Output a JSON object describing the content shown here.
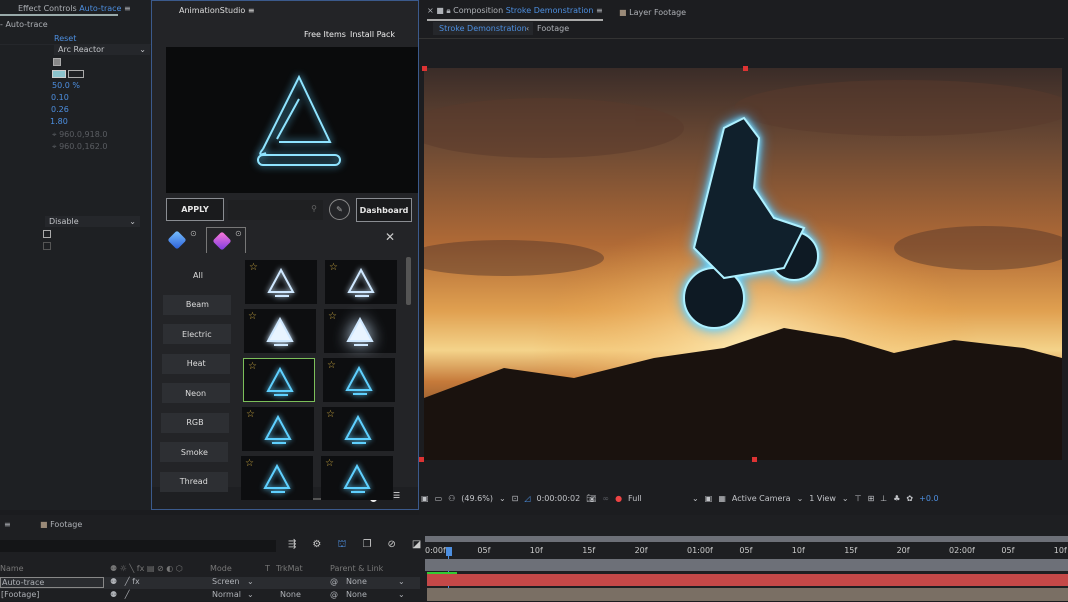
{
  "effect_controls": {
    "tab_prefix": "Effect Controls",
    "tab_layer": "Auto-trace",
    "effect_name": "Auto-trace",
    "reset": "Reset",
    "preset": "Arc Reactor",
    "values": [
      "50.0 %",
      "0.10",
      "0.26",
      "1.80"
    ],
    "points": [
      "960.0,918.0",
      "960.0,162.0"
    ],
    "mode": "Disable"
  },
  "plugin": {
    "title": "AnimationStudio",
    "free_items": "Free Items",
    "install_pack": "Install Pack",
    "apply": "APPLY",
    "dashboard": "Dashboard",
    "search_placeholder": "",
    "categories": [
      "All",
      "Beam",
      "Electric",
      "Heat",
      "Neon",
      "RGB",
      "Smoke",
      "Thread"
    ],
    "selected_thumb": 4,
    "accent": "#5fd0ff"
  },
  "composition": {
    "close": "×",
    "tab_prefix": "Composition",
    "tab_name": "Stroke Demonstration",
    "layer_tab": "Layer Footage",
    "breadcrumb": [
      "Stroke Demonstration",
      "Footage"
    ],
    "toolbar": {
      "zoom": "(49.6%)",
      "timecode": "0:00:00:02",
      "resolution": "Full",
      "camera": "Active Camera",
      "views": "1 View",
      "exposure": "+0.0"
    }
  },
  "timeline": {
    "tab": "Footage",
    "columns": {
      "name": "Name",
      "mode": "Mode",
      "t": "T",
      "trkmat": "TrkMat",
      "parent": "Parent & Link"
    },
    "layers": [
      {
        "name": "Auto-trace",
        "mode": "Screen",
        "trkmat": "",
        "parent": "None"
      },
      {
        "name": "[Footage]",
        "mode": "Normal",
        "trkmat": "None",
        "parent": "None"
      }
    ],
    "ruler": [
      "0:00f",
      "05f",
      "10f",
      "15f",
      "20f",
      "01:00f",
      "05f",
      "10f",
      "15f",
      "20f",
      "02:00f",
      "05f",
      "10f"
    ]
  }
}
